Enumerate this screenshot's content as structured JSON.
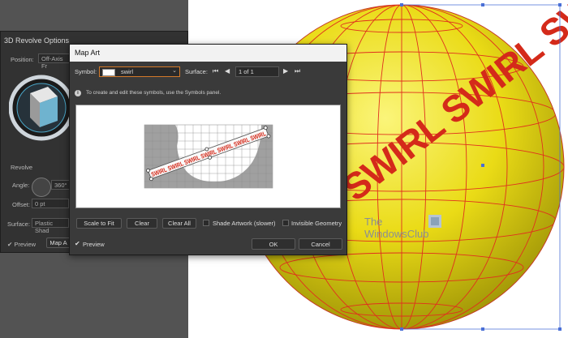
{
  "back_dialog": {
    "title": "3D Revolve Options",
    "position_label": "Position:",
    "position_value": "Off-Axis Fr",
    "revolve_label": "Revolve",
    "angle_label": "Angle:",
    "angle_value": "360°",
    "offset_label": "Offset:",
    "offset_value": "0 pt",
    "surface_label": "Surface:",
    "surface_value": "Plastic Shad",
    "preview_label": "Preview",
    "map_art_label": "Map A"
  },
  "map_art": {
    "title": "Map Art",
    "symbol_label": "Symbol:",
    "symbol_value": "swirl",
    "surface_label": "Surface:",
    "surface_page": "1 of 1",
    "info_text": "To create and edit these symbols, use the Symbols panel.",
    "art_text": "SWIRL SWIRL SWIRL SWIRL SWIRL SWIRL SWIRL",
    "scale_to_fit_label": "Scale to Fit",
    "clear_label": "Clear",
    "clear_all_label": "Clear All",
    "shade_label": "Shade Artwork (slower)",
    "invisible_label": "Invisible Geometry",
    "preview_label": "Preview",
    "ok_label": "OK",
    "cancel_label": "Cancel"
  },
  "canvas": {
    "globe_text": "SWIRL SWIRL SWIRL SWIRL",
    "globe_fill": "#f2e61a",
    "mesh_color": "#e0301e"
  },
  "watermark": {
    "line1": "The",
    "line2": "WindowsClub"
  }
}
